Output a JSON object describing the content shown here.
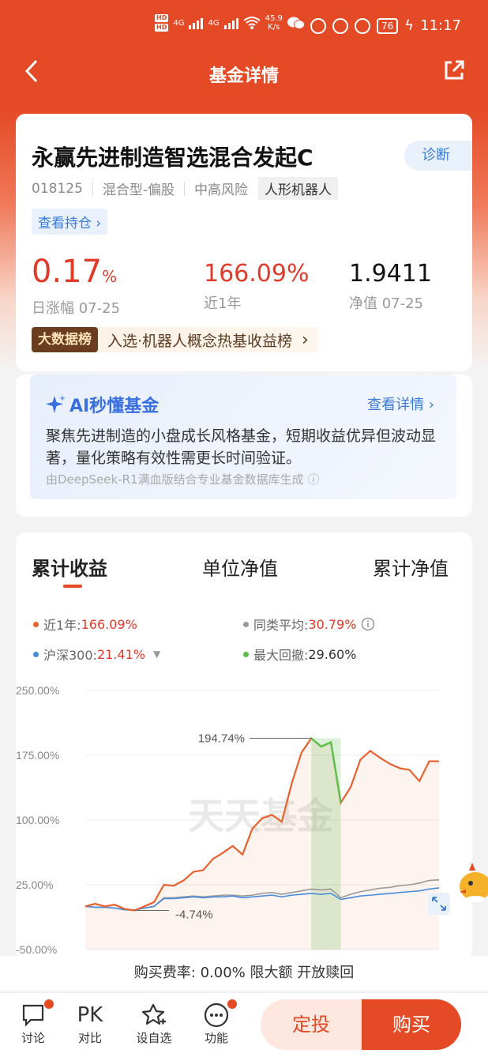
{
  "status_bar": {
    "hd1": "HD",
    "hd2": "HD",
    "net1": "4G",
    "net2": "4G",
    "speed": "45.9",
    "speed_unit": "K/s",
    "battery": "76",
    "time": "11:17"
  },
  "nav": {
    "title": "基金详情"
  },
  "fund": {
    "name": "永赢先进制造智选混合发起C",
    "diagnose_label": "诊断",
    "code": "018125",
    "type": "混合型-偏股",
    "risk": "中高风险",
    "theme_tag": "人形机器人",
    "holdings_label": "查看持仓 ›",
    "daily_change_value": "0.17",
    "daily_change_unit": "%",
    "daily_change_label": "日涨幅 07-25",
    "year_return_value": "166.09%",
    "year_return_label": "近1年",
    "nav_value": "1.9411",
    "nav_label": "净值 07-25",
    "rank_badge": "大数据榜",
    "rank_text": "入选·机器人概念热基收益榜",
    "rank_arrow": "›"
  },
  "ai": {
    "title": "AI秒懂基金",
    "more_label": "查看详情 ›",
    "summary": "聚焦先进制造的小盘成长风格基金，短期收益优异但波动显著，量化策略有效性需更长时间验证。",
    "footnote": "由DeepSeek-R1满血版结合专业基金数据库生成 ⓘ"
  },
  "chart_tabs": [
    "累计收益",
    "单位净值",
    "累计净值"
  ],
  "legend": {
    "fund_label": "近1年:",
    "fund_value": "166.09%",
    "peer_label": "同类平均:",
    "peer_value": "30.79%",
    "index_label": "沪深300:",
    "index_value": "21.41%",
    "drawdown_label": "最大回撤:",
    "drawdown_value": "29.60%"
  },
  "colors": {
    "brand": "#e44a25",
    "fund_line": "#e8622f",
    "peer_line": "#999999",
    "index_line": "#4a8bdc",
    "drawdown": "#5cbf4c"
  },
  "watermark": "天天基金",
  "chart_data": {
    "type": "line",
    "ylim": [
      -50,
      250
    ],
    "yticks": [
      "250.00%",
      "175.00%",
      "100.00%",
      "25.00%",
      "-50.00%"
    ],
    "annotations": {
      "max": "194.74%",
      "min": "-4.74%"
    },
    "series": [
      {
        "name": "近1年",
        "values": [
          0,
          3,
          0,
          2,
          -3,
          -4.7,
          0,
          5,
          25,
          24,
          30,
          40,
          42,
          55,
          62,
          70,
          60,
          90,
          102,
          106,
          98,
          142,
          178,
          194.7,
          185,
          190,
          120,
          138,
          170,
          180,
          172,
          165,
          160,
          158,
          145,
          168,
          168
        ]
      },
      {
        "name": "同类平均",
        "values": [
          0,
          -1,
          -1,
          -2,
          -3,
          -4,
          -2,
          0,
          10,
          10,
          11,
          12,
          11,
          12,
          13,
          13,
          12,
          13,
          15,
          16,
          14,
          16,
          18,
          20,
          19,
          20,
          10,
          14,
          17,
          19,
          21,
          22,
          24,
          25,
          27,
          30,
          30.8
        ]
      },
      {
        "name": "沪深300",
        "values": [
          0,
          -1,
          -1,
          -2,
          -4,
          -4.5,
          -2,
          0,
          9,
          9,
          10,
          11,
          10,
          11,
          11,
          12,
          10,
          11,
          12,
          13,
          11,
          13,
          14,
          15,
          14,
          15,
          8,
          10,
          12,
          13,
          14,
          15,
          16,
          17,
          18,
          20,
          21.4
        ]
      }
    ],
    "drawdown_range": [
      23,
      26
    ]
  },
  "bottom": {
    "fee_text": "购买费率: 0.00%  限大额  开放赎回",
    "discuss": "讨论",
    "pk_icon": "PK",
    "compare": "对比",
    "watchlist": "设自选",
    "more": "功能",
    "sip": "定投",
    "buy": "购买"
  }
}
